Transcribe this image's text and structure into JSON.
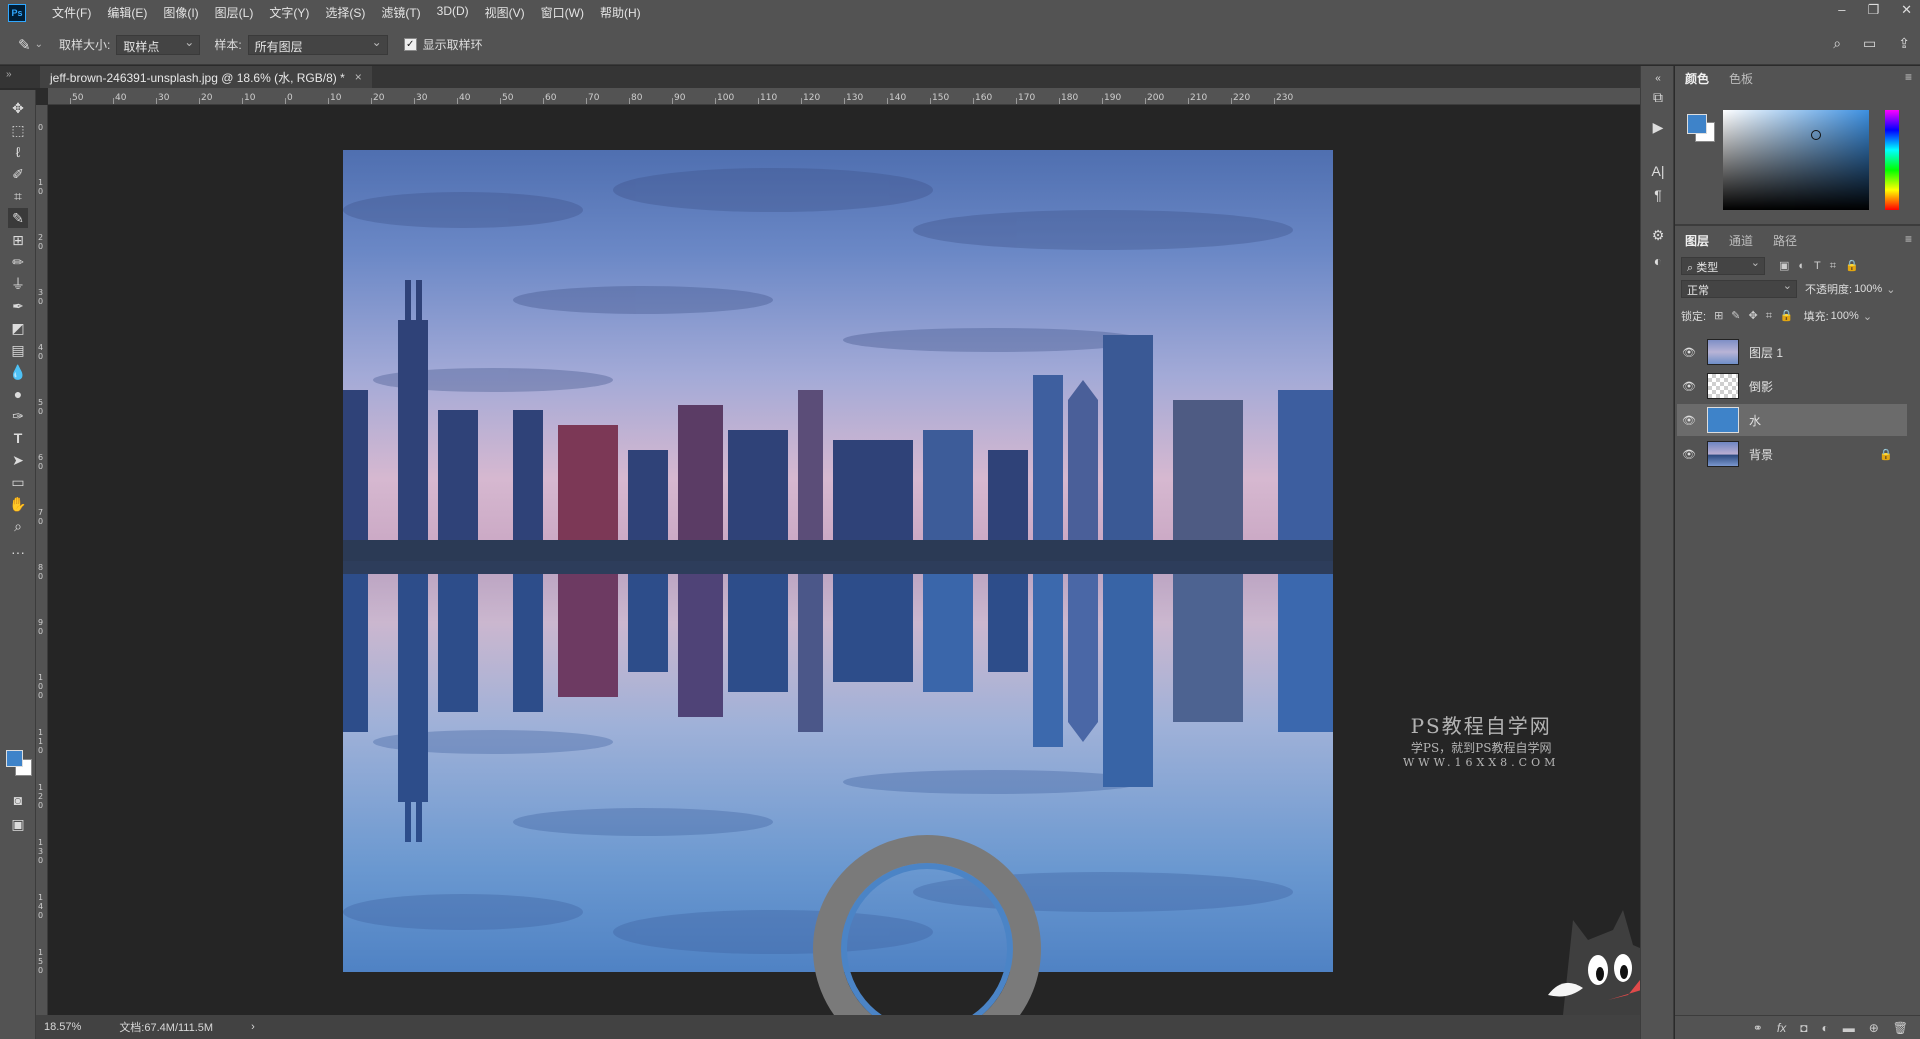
{
  "menubar": {
    "logo": "Ps",
    "items": [
      "文件(F)",
      "编辑(E)",
      "图像(I)",
      "图层(L)",
      "文字(Y)",
      "选择(S)",
      "滤镜(T)",
      "3D(D)",
      "视图(V)",
      "窗口(W)",
      "帮助(H)"
    ],
    "window_controls": [
      "–",
      "❐",
      "✕"
    ]
  },
  "options": {
    "sample_size_label": "取样大小:",
    "sample_size_value": "取样点",
    "sample_label": "样本:",
    "sample_value": "所有图层",
    "show_ring_label": "显示取样环",
    "show_ring_checked": true
  },
  "document": {
    "tab_title": "jeff-brown-246391-unsplash.jpg @ 18.6% (水, RGB/8) *",
    "close": "×"
  },
  "ruler": {
    "h_ticks": [
      "50",
      "40",
      "30",
      "20",
      "10",
      "0",
      "10",
      "20",
      "30",
      "40",
      "50",
      "60",
      "70",
      "80",
      "90",
      "100",
      "110",
      "120",
      "130",
      "140",
      "150",
      "160",
      "170",
      "180",
      "190",
      "200",
      "210",
      "220",
      "230"
    ],
    "v_ticks": [
      "0",
      "1 0",
      "2 0",
      "3 0",
      "4 0",
      "5 0",
      "6 0",
      "7 0",
      "8 0",
      "9 0",
      "1 0 0",
      "1 1 0",
      "1 2 0",
      "1 3 0",
      "1 4 0",
      "1 5 0"
    ]
  },
  "watermark": {
    "line1": "PS教程自学网",
    "line2": "学PS，就到PS教程自学网",
    "line3": "WWW.16XX8.COM"
  },
  "status": {
    "zoom": "18.57%",
    "doc": "文档:67.4M/111.5M",
    "arrow": "›"
  },
  "panels": {
    "color_tabs": [
      "颜色",
      "色板"
    ],
    "layers_tabs": [
      "图层",
      "通道",
      "路径"
    ],
    "filter_kind": "类型",
    "blend_mode": "正常",
    "opacity_label": "不透明度:",
    "opacity_value": "100%",
    "lock_label": "锁定:",
    "fill_label": "填充:",
    "fill_value": "100%",
    "layers": [
      {
        "name": "图层 1",
        "selected": false,
        "locked": false
      },
      {
        "name": "倒影",
        "selected": false,
        "locked": false
      },
      {
        "name": "水",
        "selected": true,
        "locked": false
      },
      {
        "name": "背景",
        "selected": false,
        "locked": true
      }
    ],
    "footer_icons": [
      "link-icon",
      "fx-icon",
      "mask-icon",
      "adjustment-icon",
      "folder-icon",
      "new-layer-icon",
      "trash-icon"
    ]
  },
  "colors": {
    "foreground": "#3e83c9",
    "background": "#ffffff",
    "water_fill": "#3e83c9"
  }
}
